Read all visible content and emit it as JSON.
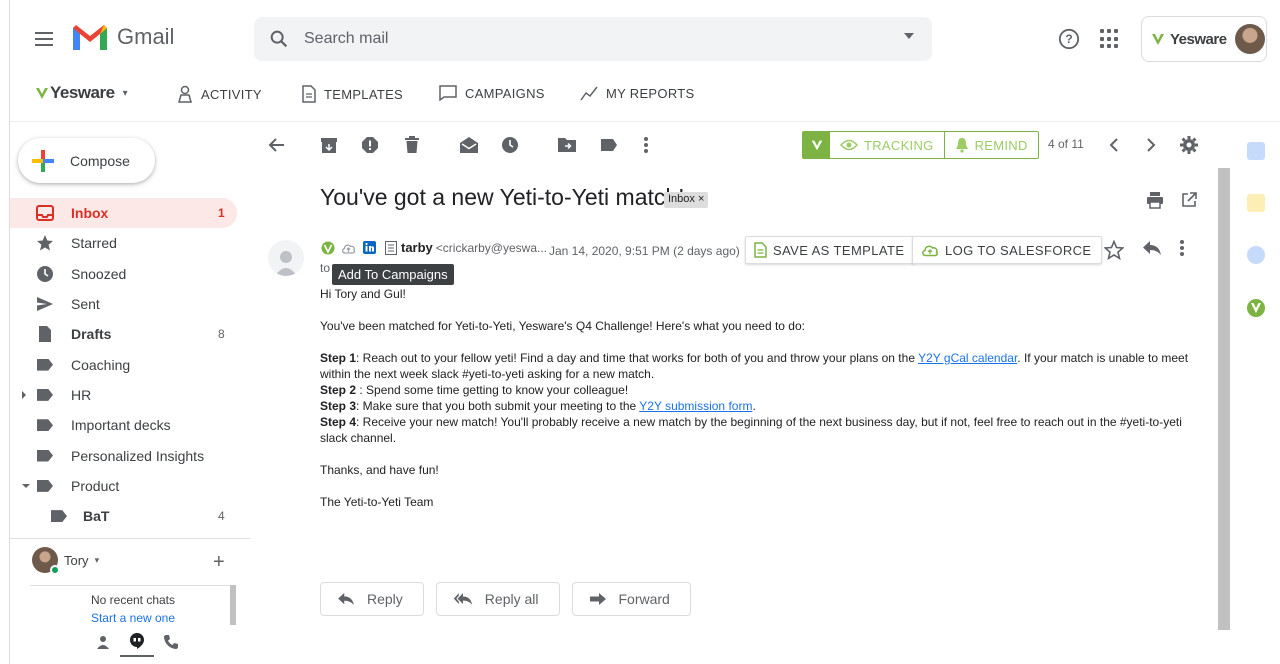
{
  "topbar": {
    "app_name": "Gmail",
    "search_placeholder": "Search mail",
    "account_brand": "Yesware"
  },
  "yesware_bar": {
    "brand": "Yesware",
    "nav": [
      {
        "label": "ACTIVITY",
        "icon": "person-icon"
      },
      {
        "label": "TEMPLATES",
        "icon": "document-icon"
      },
      {
        "label": "CAMPAIGNS",
        "icon": "chat-icon"
      },
      {
        "label": "MY REPORTS",
        "icon": "trend-icon"
      }
    ]
  },
  "sidebar": {
    "compose_label": "Compose",
    "items": [
      {
        "label": "Inbox",
        "count": "1",
        "active": true,
        "icon": "inbox-icon"
      },
      {
        "label": "Starred",
        "count": "",
        "icon": "star-icon"
      },
      {
        "label": "Snoozed",
        "count": "",
        "icon": "clock-icon"
      },
      {
        "label": "Sent",
        "count": "",
        "icon": "send-icon"
      },
      {
        "label": "Drafts",
        "count": "8",
        "icon": "draft-icon",
        "bold": true
      },
      {
        "label": "Coaching",
        "count": "",
        "icon": "label-icon"
      },
      {
        "label": "HR",
        "count": "",
        "icon": "label-icon",
        "expandable": "collapsed"
      },
      {
        "label": "Important decks",
        "count": "",
        "icon": "label-icon"
      },
      {
        "label": "Personalized Insights",
        "count": "",
        "icon": "label-icon"
      },
      {
        "label": "Product",
        "count": "",
        "icon": "label-icon",
        "expandable": "expanded"
      },
      {
        "label": "BaT",
        "count": "4",
        "icon": "label-icon",
        "sub": true
      }
    ],
    "hangouts": {
      "user": "Tory",
      "no_chats": "No recent chats",
      "start_chat": "Start a new one"
    }
  },
  "toolbar": {
    "tracking_label": "TRACKING",
    "remind_label": "REMIND",
    "pager": "4 of 11"
  },
  "message": {
    "subject": "You've got a new Yeti-to-Yeti match!",
    "inbox_chip": "Inbox ×",
    "sender_name": "tarby",
    "sender_email": "<crickarby@yeswa...",
    "date": "Jan 14, 2020, 9:51 PM (2 days ago)",
    "to": "to",
    "tooltip": "Add To Campaigns",
    "save_template": "SAVE AS TEMPLATE",
    "log_salesforce": "LOG TO SALESFORCE",
    "body": {
      "greeting": "Hi Tory and Gul!",
      "intro": "You've been matched for Yeti-to-Yeti, Yesware's Q4 Challenge! Here's what you need to do:",
      "step1_label": "Step 1",
      "step1_a": ": Reach out to your fellow yeti! Find a day and time that works for both of you and throw your plans on the ",
      "step1_link": "Y2Y gCal calendar",
      "step1_b": ".  If your match is unable to meet within the next week slack #yeti-to-yeti asking for a new match.",
      "step2_label": "Step 2",
      "step2": " : Spend some time getting to know your colleague!",
      "step3_label": "Step 3",
      "step3_a": ": Make sure that you both submit your meeting to the ",
      "step3_link": "Y2Y submission form",
      "step3_b": ".",
      "step4_label": "Step 4",
      "step4": ": Receive your new match! You'll probably receive a new match by the beginning of the next business day, but if not, feel free to reach out in the #yeti-to-yeti slack channel.",
      "thanks": "Thanks, and have fun!",
      "signature": "The Yeti-to-Yeti Team"
    },
    "reply_label": "Reply",
    "reply_all_label": "Reply all",
    "forward_label": "Forward"
  },
  "colors": {
    "gmail_red": "#d93025",
    "yesware_green": "#7cb342",
    "link_blue": "#1a73e8"
  }
}
